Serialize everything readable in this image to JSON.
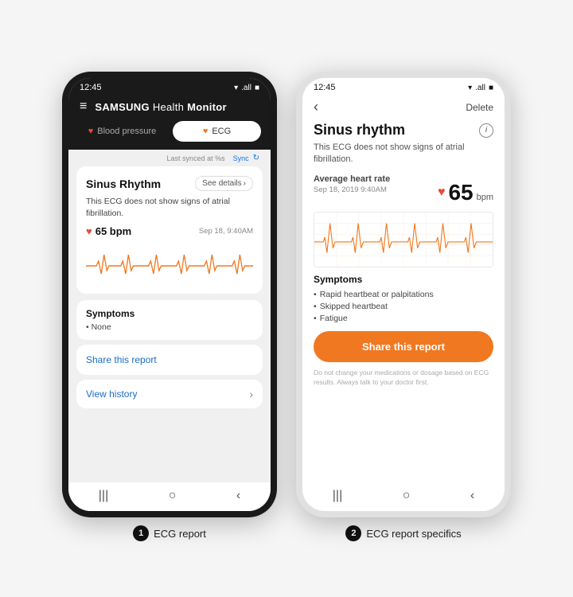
{
  "phone1": {
    "statusBar": {
      "time": "12:45",
      "icons": "▾ .all ■"
    },
    "header": {
      "menu": "≡",
      "brand": "SAMSUNG",
      "appName": " Health ",
      "appSub": "Monitor"
    },
    "tabs": {
      "bp": "Blood pressure",
      "ecg": "ECG"
    },
    "syncBar": {
      "text": "Last synced at %s",
      "syncBtn": "Sync"
    },
    "card": {
      "title": "Sinus Rhythm",
      "seeDetails": "See details",
      "description": "This ECG does not show signs of atrial fibrillation.",
      "bpm": "65 bpm",
      "date": "Sep 18, 9:40AM"
    },
    "symptoms": {
      "title": "Symptoms",
      "items": [
        "None"
      ]
    },
    "shareReport": "Share this report",
    "viewHistory": "View history",
    "navIcons": [
      "|||",
      "○",
      "<"
    ]
  },
  "phone2": {
    "statusBar": {
      "time": "12:45",
      "icons": "▾ .all ■"
    },
    "navTop": {
      "back": "‹",
      "delete": "Delete"
    },
    "title": "Sinus rhythm",
    "subtitle": "This ECG does not show signs of atrial fibrillation.",
    "heartRate": {
      "label": "Average heart rate",
      "date": "Sep 18, 2019 9:40AM",
      "value": "65",
      "unit": "bpm"
    },
    "symptoms": {
      "title": "Symptoms",
      "items": [
        "Rapid heartbeat or palpitations",
        "Skipped heartbeat",
        "Fatigue"
      ]
    },
    "shareBtn": "Share this report",
    "disclaimer": "Do not change your medications or dosage based on ECG results. Always talk to your doctor first.",
    "navIcons": [
      "|||",
      "○",
      "<"
    ]
  },
  "labels": {
    "badge1": "1",
    "label1": "ECG report",
    "badge2": "2",
    "label2": "ECG report specifics"
  }
}
